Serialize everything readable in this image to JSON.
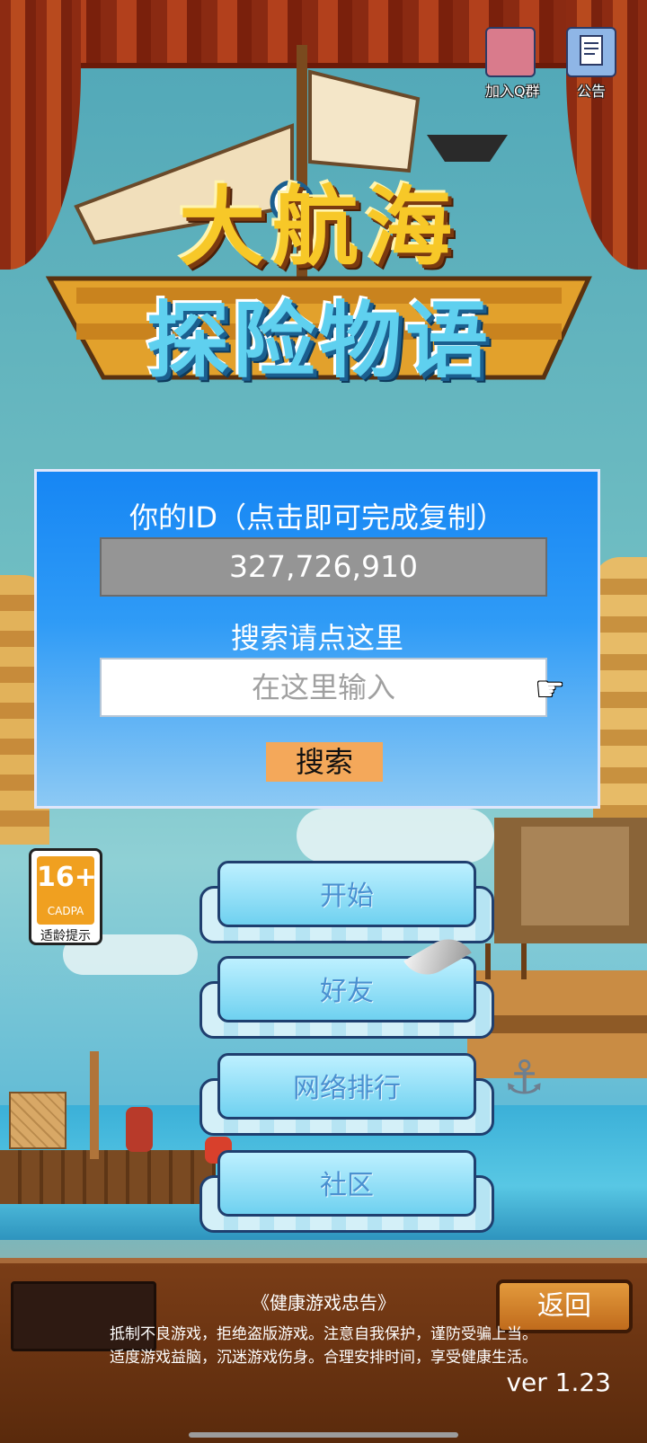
{
  "top_icons": {
    "qq_group_label": "加入Q群",
    "notice_label": "公告"
  },
  "logo": {
    "line1": "大航海",
    "line2": "探险物语"
  },
  "id_panel": {
    "title": "你的ID（点击即可完成复制）",
    "id_value": "327,726,910",
    "search_hint": "搜索请点这里",
    "search_placeholder": "在这里输入",
    "search_button": "搜索"
  },
  "age_rating": {
    "age": "16+",
    "org": "CADPA",
    "tip": "适龄提示"
  },
  "menu": {
    "start": "开始",
    "friends": "好友",
    "ranking": "网络排行",
    "community": "社区"
  },
  "bottom": {
    "back_button": "返回",
    "health_title": "《健康游戏忠告》",
    "health_line1": "抵制不良游戏，拒绝盗版游戏。注意自我保护，谨防受骗上当。",
    "health_line2": "适度游戏益脑，沉迷游戏伤身。合理安排时间，享受健康生活。",
    "version": "ver 1.23"
  },
  "colors": {
    "panel_blue": "#1686f4",
    "search_button": "#f4a85a",
    "menu_text": "#4a90d0",
    "bottom_bar": "#7a3d17"
  }
}
